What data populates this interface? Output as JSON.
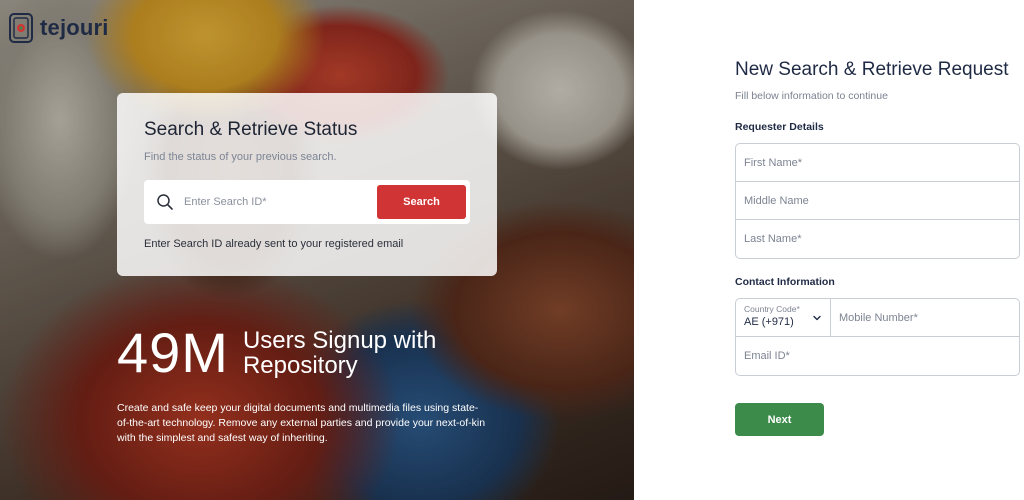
{
  "brand": {
    "name": "tejouri"
  },
  "status_card": {
    "title": "Search & Retrieve Status",
    "subtitle": "Find the status of your previous search.",
    "search_placeholder": "Enter Search ID*",
    "search_button": "Search",
    "hint": "Enter Search ID already sent to your registered email"
  },
  "hero": {
    "stat_number": "49M",
    "stat_label": "Users Signup with Repository",
    "description": "Create and safe keep your digital documents and multimedia files using state-of-the-art technology. Remove any external parties and provide your next-of-kin with the simplest and safest way of inheriting."
  },
  "form": {
    "title": "New Search & Retrieve Request",
    "subtitle": "Fill below information to continue",
    "requester_section": "Requester Details",
    "first_name_placeholder": "First Name*",
    "middle_name_placeholder": "Middle Name",
    "last_name_placeholder": "Last Name*",
    "contact_section": "Contact Information",
    "country_code_label": "Country Code*",
    "country_code_value": "AE (+971)",
    "mobile_placeholder": "Mobile Number*",
    "email_placeholder": "Email ID*",
    "next_button": "Next"
  },
  "colors": {
    "search_button": "#d13434",
    "next_button": "#3d8b4a",
    "heading": "#1f2a44"
  },
  "icons": {
    "logo": "tejouri-logo-icon",
    "search": "search-icon",
    "dropdown": "chevron-down-icon"
  }
}
